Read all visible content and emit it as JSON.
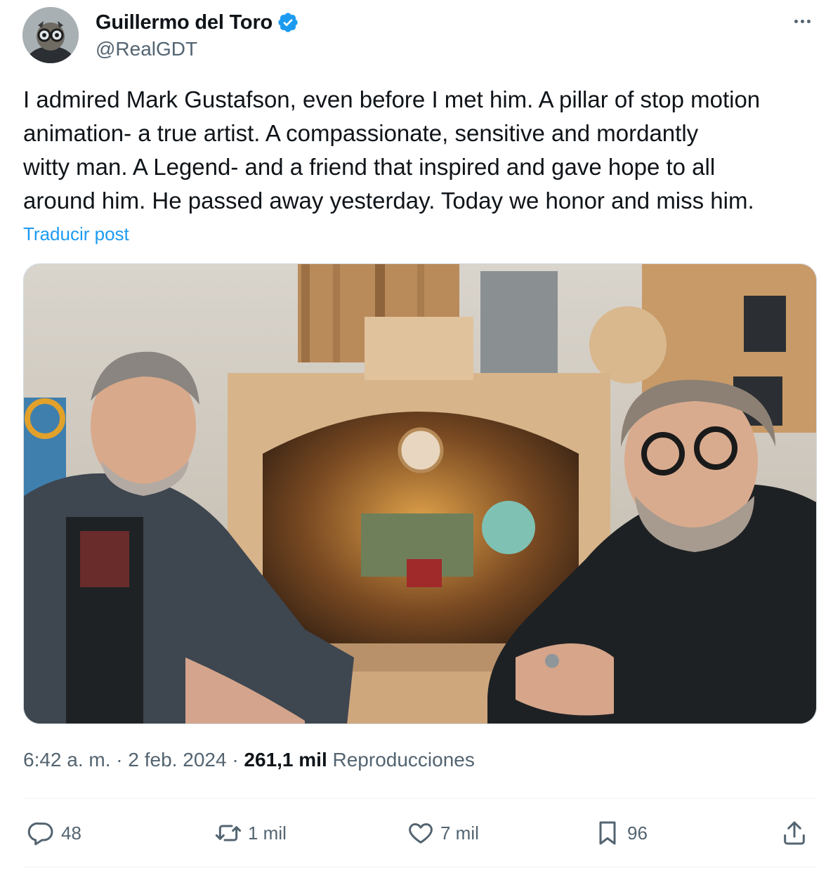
{
  "author": {
    "name": "Guillermo del Toro",
    "handle": "@RealGDT",
    "verified": true
  },
  "tweet": {
    "text": "I admired Mark Gustafson, even before I met him.  A pillar of stop motion\nanimation- a true artist.  A compassionate, sensitive and mordantly\nwitty man.  A Legend- and a friend that inspired and gave hope to all\naround him.  He passed away yesterday.  Today we honor and miss him.",
    "translate_label": "Traducir post"
  },
  "meta": {
    "time": "6:42 a. m.",
    "separator": "·",
    "date": "2 feb. 2024",
    "views_count": "261,1 mil",
    "views_label": "Reproducciones"
  },
  "actions": {
    "replies": "48",
    "reposts": "1 mil",
    "likes": "7 mil",
    "bookmarks": "96"
  },
  "icons": {
    "more": "more-dots-icon",
    "verified": "verified-badge-icon",
    "reply": "reply-icon",
    "repost": "repost-icon",
    "like": "heart-icon",
    "bookmark": "bookmark-icon",
    "share": "share-icon"
  },
  "colors": {
    "accent": "#1d9bf0",
    "text_secondary": "#536471",
    "text_primary": "#0f1419"
  }
}
